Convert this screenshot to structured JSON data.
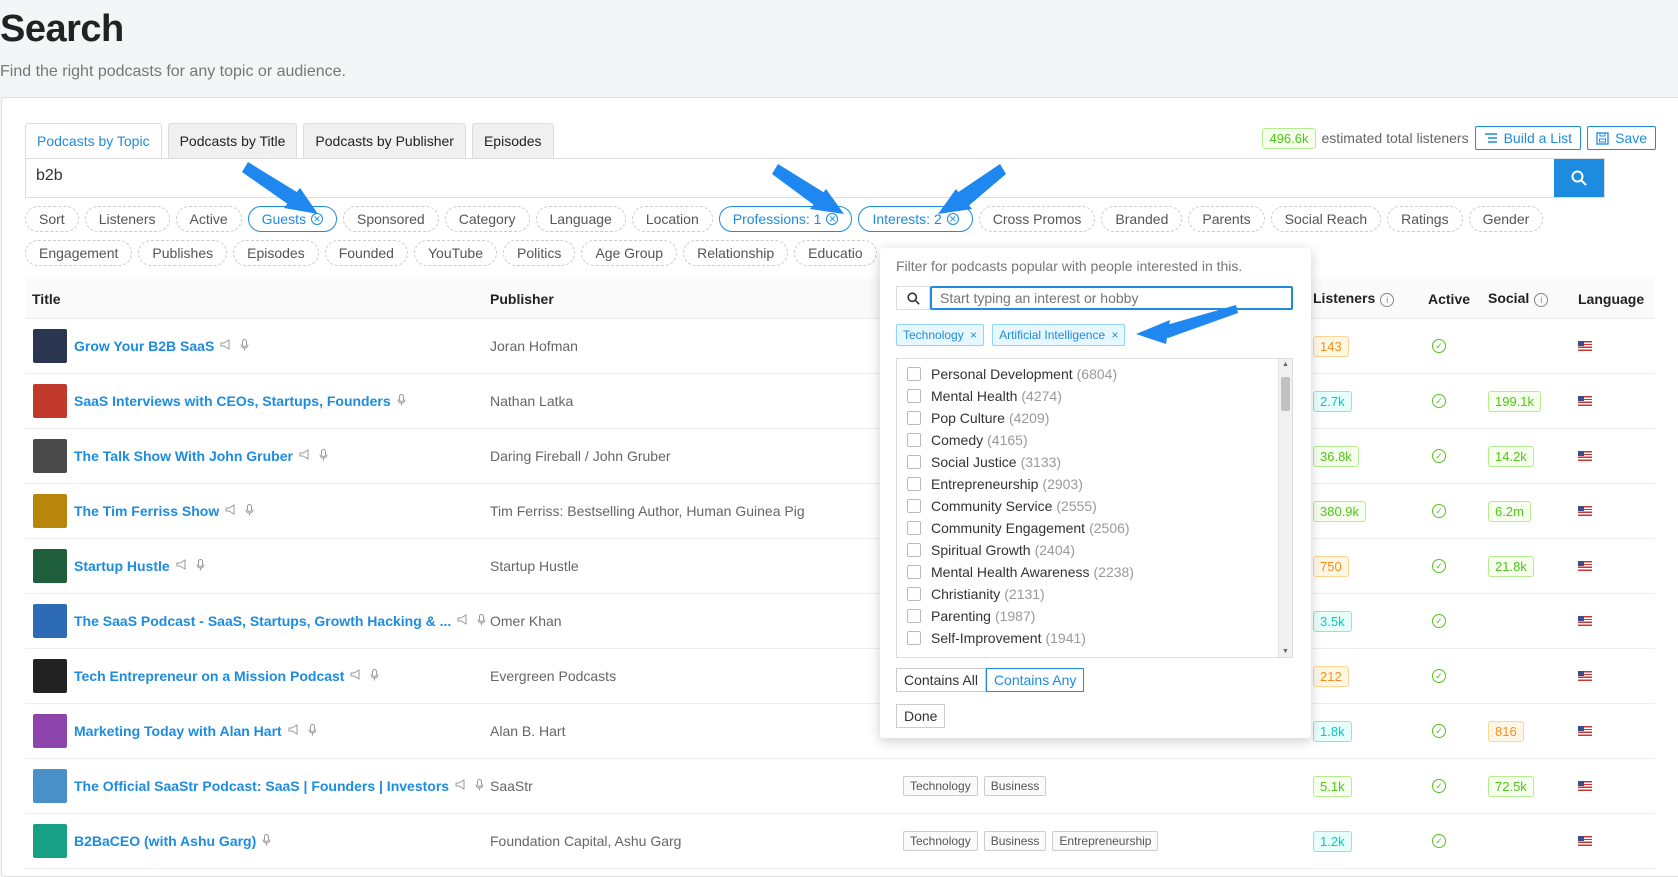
{
  "header": {
    "title": "Search",
    "subtitle": "Find the right podcasts for any topic or audience."
  },
  "tabs": [
    {
      "label": "Podcasts by Topic",
      "active": true
    },
    {
      "label": "Podcasts by Title"
    },
    {
      "label": "Podcasts by Publisher"
    },
    {
      "label": "Episodes"
    }
  ],
  "toolbar": {
    "listeners_badge": "496.6k",
    "listeners_text": "estimated total listeners",
    "build_list": "Build a List",
    "save": "Save"
  },
  "search": {
    "value": "b2b"
  },
  "filters_row1": [
    {
      "label": "Sort"
    },
    {
      "label": "Listeners"
    },
    {
      "label": "Active"
    },
    {
      "label": "Guests",
      "selected": true
    },
    {
      "label": "Sponsored"
    },
    {
      "label": "Category"
    },
    {
      "label": "Language"
    },
    {
      "label": "Location"
    },
    {
      "label": "Professions: 1",
      "selected": true
    },
    {
      "label": "Interests: 2",
      "selected": true
    },
    {
      "label": "Cross Promos"
    },
    {
      "label": "Branded"
    },
    {
      "label": "Parents"
    },
    {
      "label": "Social Reach"
    },
    {
      "label": "Ratings"
    },
    {
      "label": "Gender"
    }
  ],
  "filters_row2": [
    {
      "label": "Engagement"
    },
    {
      "label": "Publishes"
    },
    {
      "label": "Episodes"
    },
    {
      "label": "Founded"
    },
    {
      "label": "YouTube"
    },
    {
      "label": "Politics"
    },
    {
      "label": "Age Group"
    },
    {
      "label": "Relationship"
    },
    {
      "label": "Educatio"
    }
  ],
  "table": {
    "headers": {
      "title": "Title",
      "publisher": "Publisher",
      "listeners": "Listeners",
      "active": "Active",
      "social": "Social",
      "language": "Language"
    },
    "rows": [
      {
        "title": "Grow Your B2B SaaS",
        "icons": "both",
        "publisher": "Joran Hofman",
        "tags": [],
        "listeners": "143",
        "lc": "bo",
        "social": "",
        "sc": "",
        "art": "#2a3550"
      },
      {
        "title": "SaaS Interviews with CEOs, Startups, Founders",
        "icons": "mic",
        "publisher": "Nathan Latka",
        "tags": [],
        "listeners": "2.7k",
        "lc": "bc",
        "social": "199.1k",
        "sc": "bg",
        "art": "#c0392b"
      },
      {
        "title": "The Talk Show With John Gruber",
        "icons": "both",
        "publisher": "Daring Fireball / John Gruber",
        "tags": [],
        "listeners": "36.8k",
        "lc": "bg",
        "social": "14.2k",
        "sc": "bg",
        "art": "#4a4a4a"
      },
      {
        "title": "The Tim Ferriss Show",
        "icons": "both",
        "publisher": "Tim Ferriss: Bestselling Author, Human Guinea Pig",
        "tags": [],
        "listeners": "380.9k",
        "lc": "bg",
        "social": "6.2m",
        "sc": "bg",
        "art": "#b8860b"
      },
      {
        "title": "Startup Hustle",
        "icons": "both",
        "publisher": "Startup Hustle",
        "tags": [],
        "listeners": "750",
        "lc": "bo",
        "social": "21.8k",
        "sc": "bg",
        "art": "#1e5e3a"
      },
      {
        "title": "The SaaS Podcast - SaaS, Startups, Growth Hacking & ...",
        "icons": "both",
        "publisher": "Omer Khan",
        "tags": [],
        "listeners": "3.5k",
        "lc": "bc",
        "social": "",
        "sc": "",
        "art": "#2d6cb5"
      },
      {
        "title": "Tech Entrepreneur on a Mission Podcast",
        "icons": "both",
        "publisher": "Evergreen Podcasts",
        "tags": [],
        "listeners": "212",
        "lc": "bo",
        "social": "",
        "sc": "",
        "art": "#222222"
      },
      {
        "title": "Marketing Today with Alan Hart",
        "icons": "both",
        "publisher": "Alan B. Hart",
        "tags": [],
        "listeners": "1.8k",
        "lc": "bc",
        "social": "816",
        "sc": "bo",
        "art": "#8e44ad"
      },
      {
        "title": "The Official SaaStr Podcast: SaaS | Founders | Investors",
        "icons": "both",
        "publisher": "SaaStr",
        "tags": [
          "Technology",
          "Business"
        ],
        "listeners": "5.1k",
        "lc": "bg",
        "social": "72.5k",
        "sc": "bg",
        "art": "#4a90c8"
      },
      {
        "title": "B2BaCEO (with Ashu Garg)",
        "icons": "mic",
        "publisher": "Foundation Capital, Ashu Garg",
        "tags": [
          "Technology",
          "Business",
          "Entrepreneurship"
        ],
        "listeners": "1.2k",
        "lc": "bc",
        "social": "",
        "sc": "",
        "art": "#16a085"
      }
    ]
  },
  "dropdown": {
    "hint": "Filter for podcasts popular with people interested in this.",
    "placeholder": "Start typing an interest or hobby",
    "selected": [
      "Technology",
      "Artificial Intelligence"
    ],
    "items": [
      {
        "label": "Personal Development",
        "count": "(6804)"
      },
      {
        "label": "Mental Health",
        "count": "(4274)"
      },
      {
        "label": "Pop Culture",
        "count": "(4209)"
      },
      {
        "label": "Comedy",
        "count": "(4165)"
      },
      {
        "label": "Social Justice",
        "count": "(3133)"
      },
      {
        "label": "Entrepreneurship",
        "count": "(2903)"
      },
      {
        "label": "Community Service",
        "count": "(2555)"
      },
      {
        "label": "Community Engagement",
        "count": "(2506)"
      },
      {
        "label": "Spiritual Growth",
        "count": "(2404)"
      },
      {
        "label": "Mental Health Awareness",
        "count": "(2238)"
      },
      {
        "label": "Christianity",
        "count": "(2131)"
      },
      {
        "label": "Parenting",
        "count": "(1987)"
      },
      {
        "label": "Self-Improvement",
        "count": "(1941)"
      }
    ],
    "mode_all": "Contains All",
    "mode_any": "Contains Any",
    "done": "Done"
  },
  "colors": {
    "accent": "#1d8ce0",
    "arrow": "#1e88f0"
  }
}
